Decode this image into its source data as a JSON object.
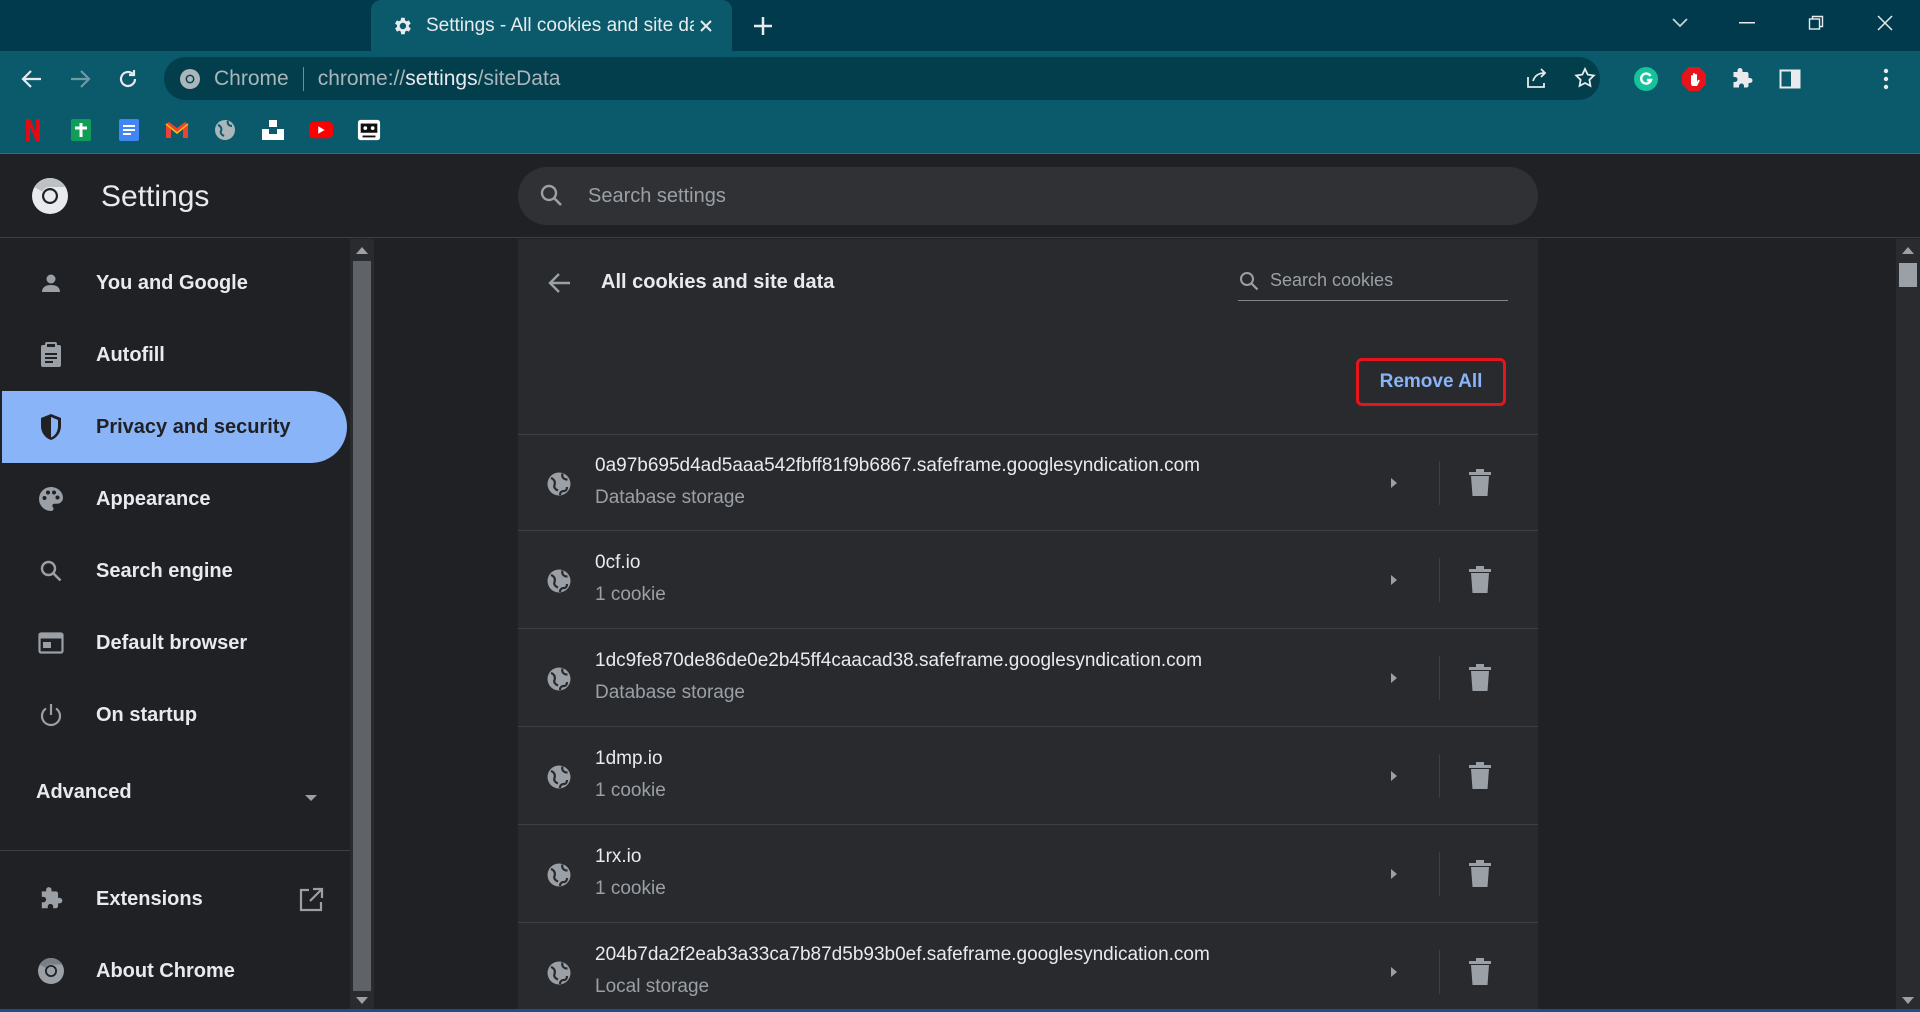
{
  "window": {
    "tab_title": "Settings - All cookies and site data",
    "colors": {
      "tab_strip": "#023a4d",
      "toolbar": "#0a5a6b",
      "accent": "#8ab4f8",
      "highlight_border": "#e8141c"
    }
  },
  "omnibox": {
    "site_label": "Chrome",
    "url_prefix": "chrome://",
    "url_host": "settings",
    "url_path": "/siteData"
  },
  "bookmarks": [
    "netflix-icon",
    "google-sheets-icon",
    "google-docs-icon",
    "gmail-icon",
    "globe-icon",
    "unsplash-icon",
    "youtube-icon",
    "bot-icon"
  ],
  "header": {
    "title": "Settings",
    "search_placeholder": "Search settings"
  },
  "nav": {
    "items": [
      {
        "label": "You and Google",
        "icon": "person-icon"
      },
      {
        "label": "Autofill",
        "icon": "clipboard-icon"
      },
      {
        "label": "Privacy and security",
        "icon": "shield-icon"
      },
      {
        "label": "Appearance",
        "icon": "palette-icon"
      },
      {
        "label": "Search engine",
        "icon": "search-icon"
      },
      {
        "label": "Default browser",
        "icon": "browser-icon"
      },
      {
        "label": "On startup",
        "icon": "power-icon"
      }
    ],
    "advanced": "Advanced",
    "extensions": "Extensions",
    "about": "About Chrome"
  },
  "card": {
    "title": "All cookies and site data",
    "search_placeholder": "Search cookies",
    "remove_all": "Remove All",
    "rows": [
      {
        "host": "0a97b695d4ad5aaa542fbff81f9b6867.safeframe.googlesyndication.com",
        "detail": "Database storage"
      },
      {
        "host": "0cf.io",
        "detail": "1 cookie"
      },
      {
        "host": "1dc9fe870de86de0e2b45ff4caacad38.safeframe.googlesyndication.com",
        "detail": "Database storage"
      },
      {
        "host": "1dmp.io",
        "detail": "1 cookie"
      },
      {
        "host": "1rx.io",
        "detail": "1 cookie"
      },
      {
        "host": "204b7da2f2eab3a33ca7b87d5b93b0ef.safeframe.googlesyndication.com",
        "detail": "Local storage"
      }
    ]
  }
}
